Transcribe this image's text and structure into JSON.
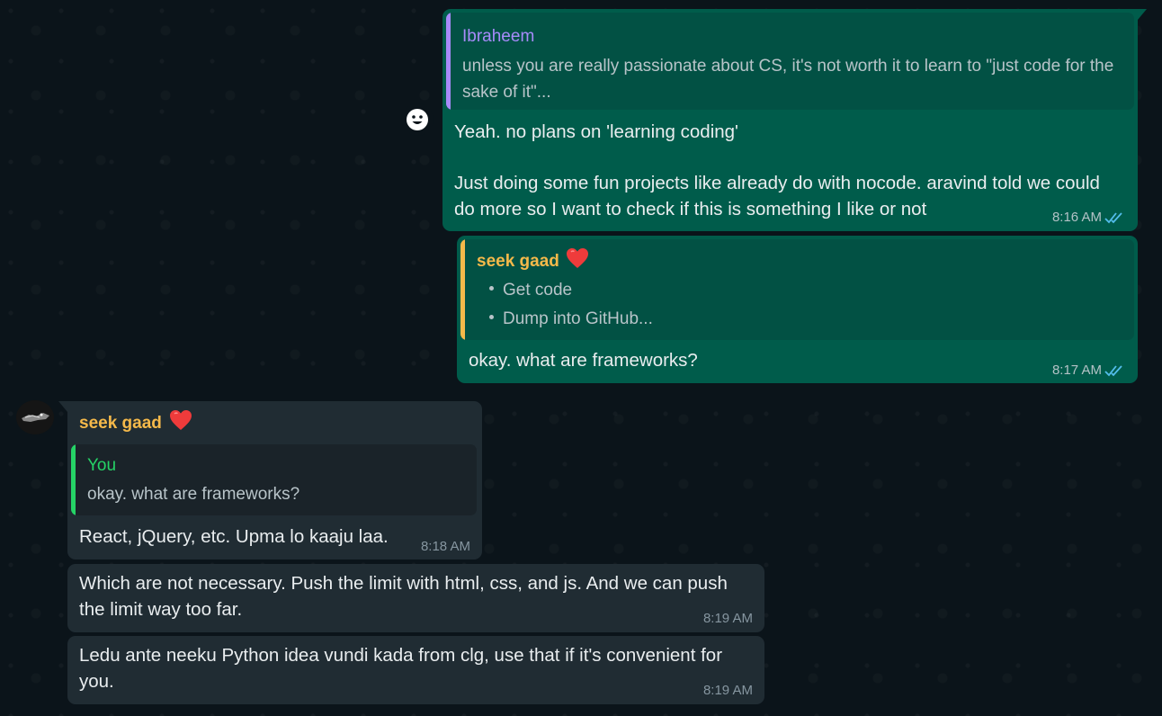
{
  "messages": {
    "m1": {
      "quote_author": "Ibraheem",
      "quote_text": "unless you are really passionate about CS, it's not worth it to learn to \"just code for the sake of it\"...",
      "text": "Yeah. no plans on 'learning coding'\n\nJust doing some fun projects like already do with nocode. aravind told we could do more so I want to check if this is something I like or not",
      "time": "8:16 AM"
    },
    "m2": {
      "quote_author": "seek gaad",
      "quote_bullets": [
        "Get code",
        "Dump into GitHub..."
      ],
      "text": "okay. what are frameworks?",
      "time": "8:17 AM"
    },
    "m3": {
      "sender": "seek gaad",
      "quote_author": "You",
      "quote_text": "okay. what are frameworks?",
      "text": "React, jQuery, etc. Upma lo kaaju laa.",
      "time": "8:18 AM"
    },
    "m4": {
      "text": "Which are not necessary. Push the limit with html, css, and js. And we can push the limit way too far.",
      "time": "8:19 AM"
    },
    "m5": {
      "text": "Ledu ante neeku Python idea vundi kada from clg, use that if it's convenient for you.",
      "time": "8:19 AM"
    }
  },
  "colors": {
    "outgoing_bubble": "#005c4b",
    "incoming_bubble": "#202c33",
    "background": "#0b141a",
    "quote_ibraheem": "#a78bfa",
    "quote_seek_gaad": "#f5b94a",
    "quote_you": "#25d366",
    "read_ticks": "#53bdeb"
  },
  "icons": {
    "reaction_emoji": "smiley-icon",
    "heart": "heart-icon",
    "read_receipt": "double-check-icon"
  }
}
